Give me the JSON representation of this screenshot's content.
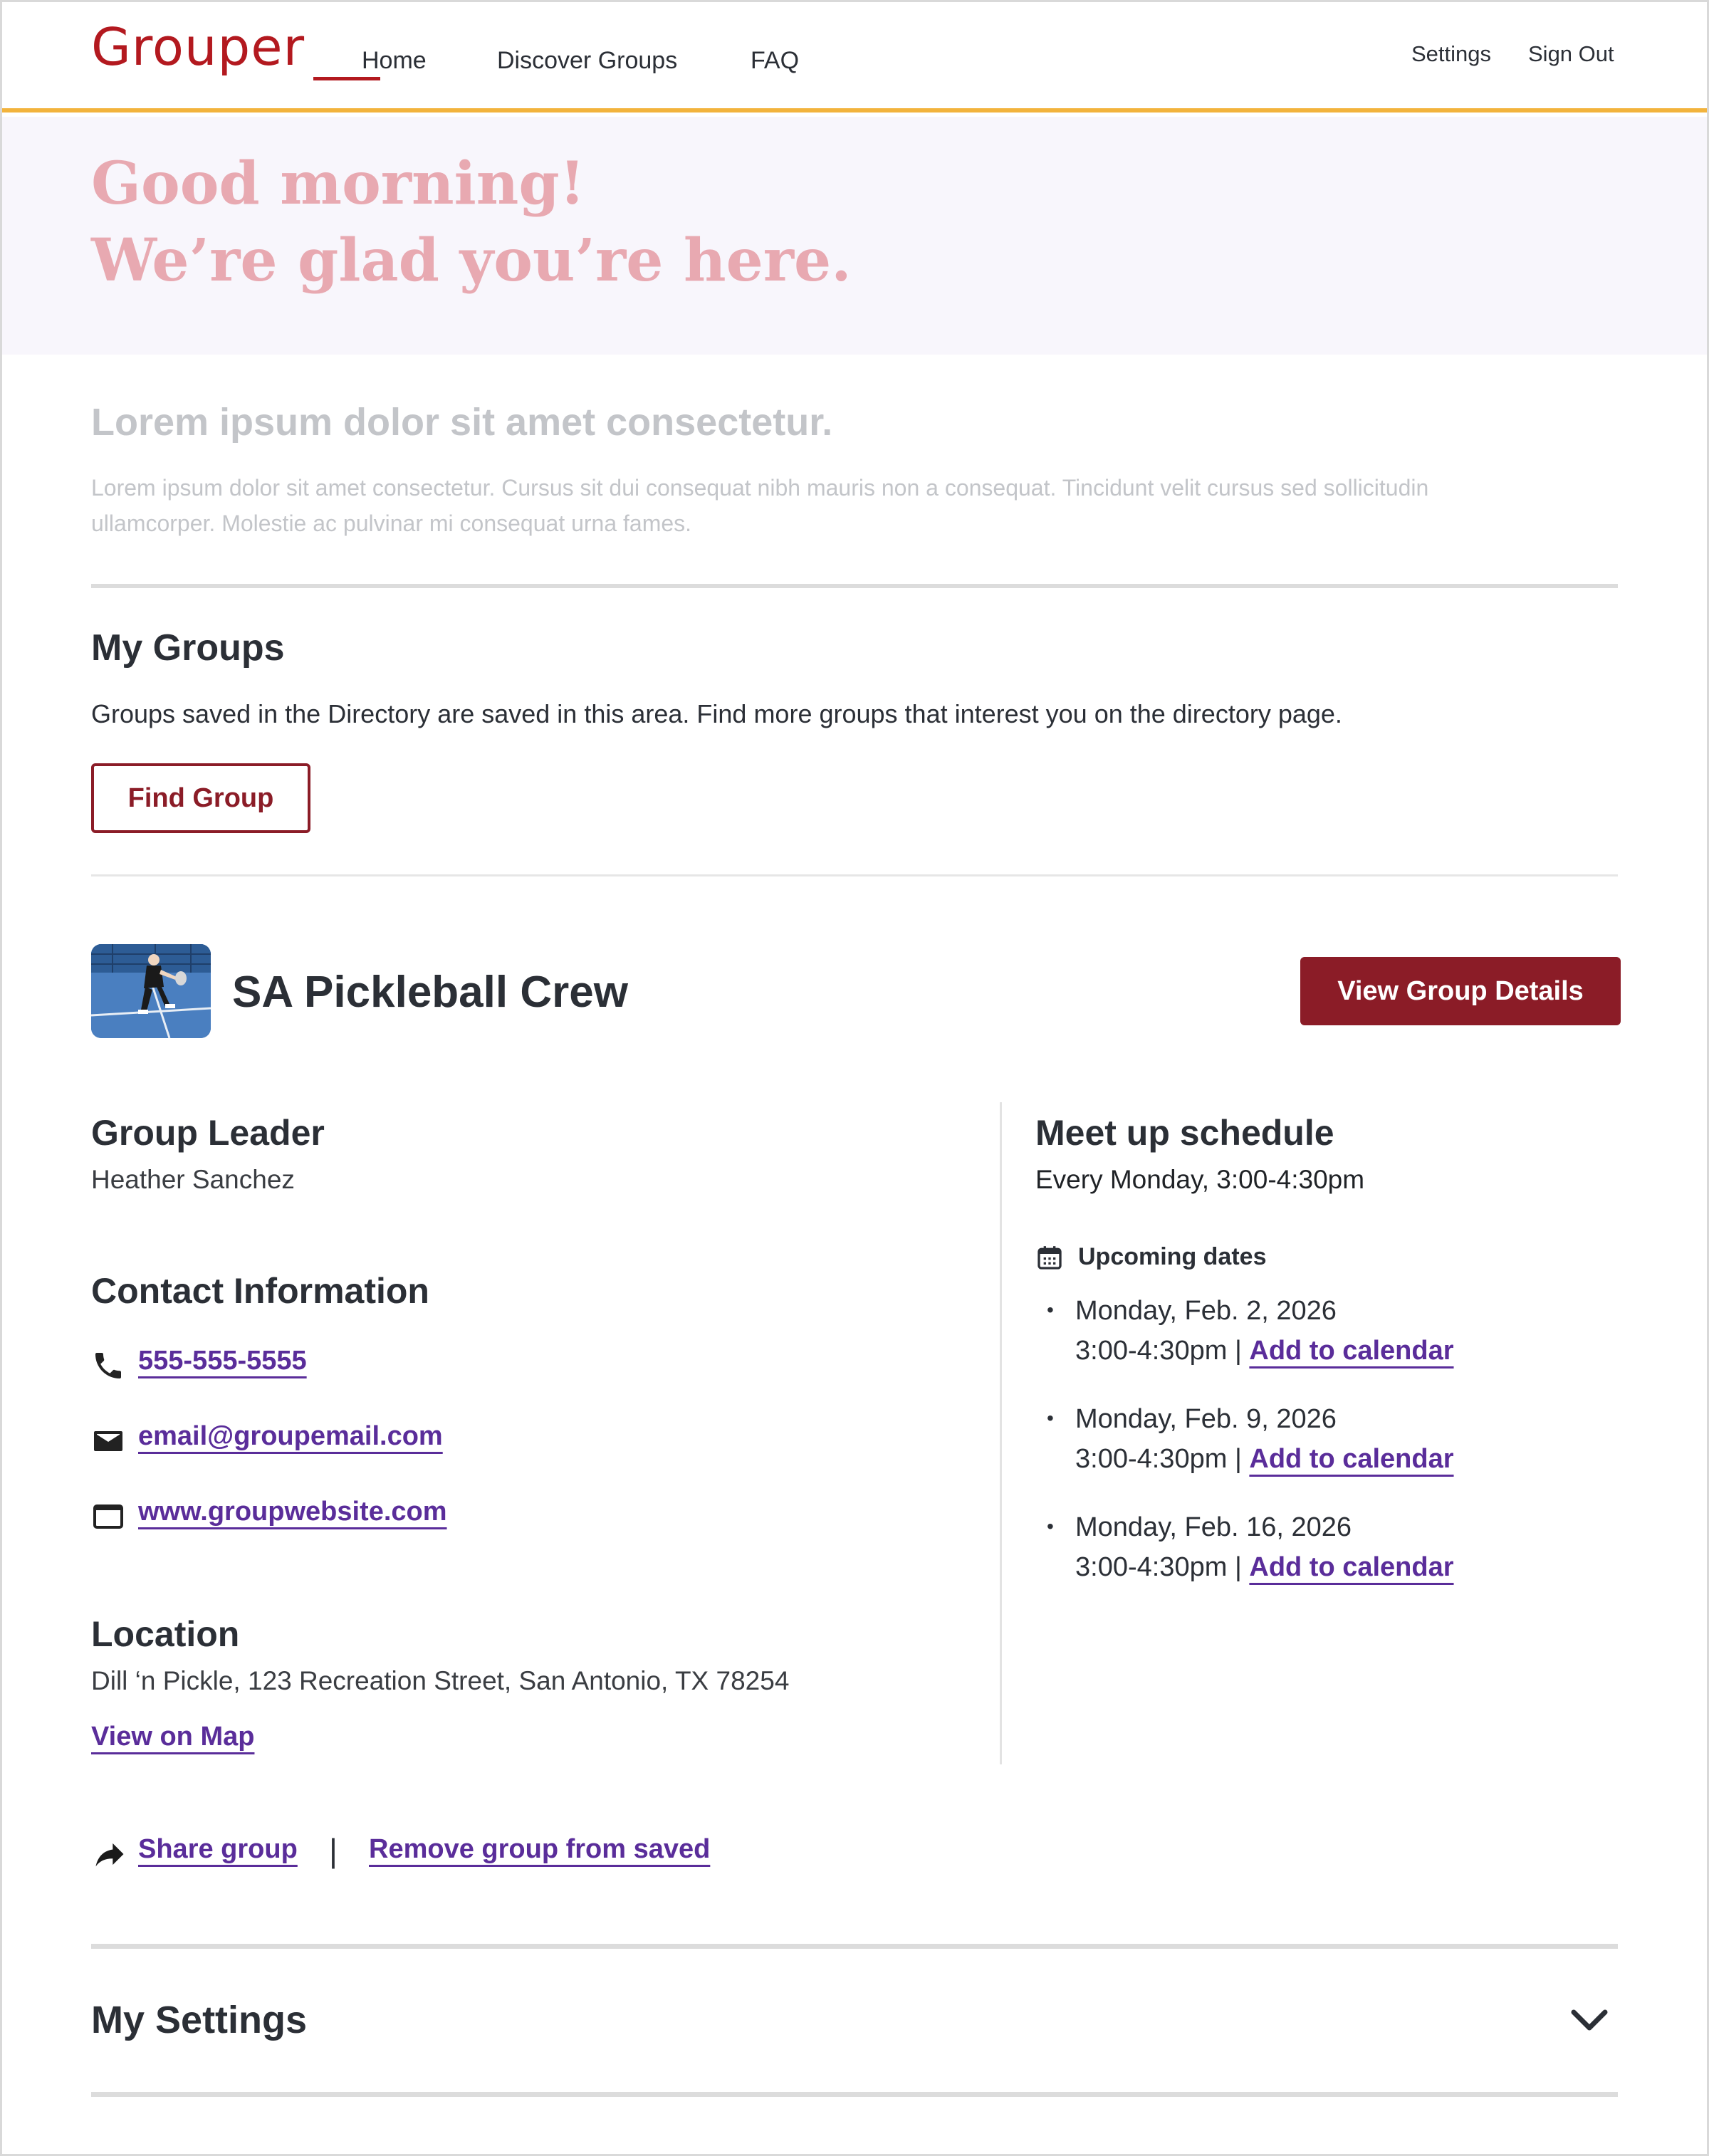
{
  "header": {
    "logo": "Grouper",
    "nav": [
      {
        "label": "Home",
        "active": true
      },
      {
        "label": "Discover Groups"
      },
      {
        "label": "FAQ"
      }
    ],
    "utility": [
      {
        "label": "Settings"
      },
      {
        "label": "Sign Out"
      }
    ],
    "accent_color": "#f2b33d",
    "brand_color": "#b3191f"
  },
  "hero": {
    "line1": "Good morning!",
    "line2": "We’re glad you’re here."
  },
  "intro": {
    "title": "Lorem ipsum dolor sit amet consectetur.",
    "body": "Lorem ipsum dolor sit amet consectetur. Cursus sit dui consequat nibh mauris non a consequat. Tincidunt velit cursus sed sollicitudin ullamcorper. Molestie ac pulvinar mi consequat urna fames."
  },
  "my_groups": {
    "title": "My Groups",
    "description": "Groups saved in the Directory are saved in this area. Find more groups that interest you on the directory page.",
    "find_button": "Find Group"
  },
  "group": {
    "name": "SA Pickleball Crew",
    "details_button": "View Group Details",
    "leader_title": "Group Leader",
    "leader_name": "Heather Sanchez",
    "contact_title": "Contact Information",
    "phone": "555-555-5555",
    "email": "email@groupemail.com",
    "website": "www.groupwebsite.com",
    "location_title": "Location",
    "location": "Dill ‘n Pickle, 123 Recreation Street, San Antonio, TX 78254",
    "map_link": "View on Map",
    "schedule_title": "Meet up schedule",
    "schedule": "Every Monday, 3:00-4:30pm",
    "upcoming_label": "Upcoming dates",
    "dates": [
      {
        "date": "Monday, Feb. 2, 2026",
        "time": "3:00-4:30pm",
        "sep": "|",
        "action": "Add to calendar"
      },
      {
        "date": "Monday, Feb. 9, 2026",
        "time": "3:00-4:30pm",
        "sep": "|",
        "action": "Add to calendar"
      },
      {
        "date": "Monday, Feb. 16, 2026",
        "time": "3:00-4:30pm",
        "sep": "|",
        "action": "Add to calendar"
      }
    ],
    "share_link": "Share group",
    "separator": "|",
    "remove_link": "Remove group from saved",
    "primary_color": "#8b1c27",
    "link_color": "#5a2d9a"
  },
  "settings": {
    "title": "My Settings",
    "expand_icon": "chevron-down-icon"
  }
}
